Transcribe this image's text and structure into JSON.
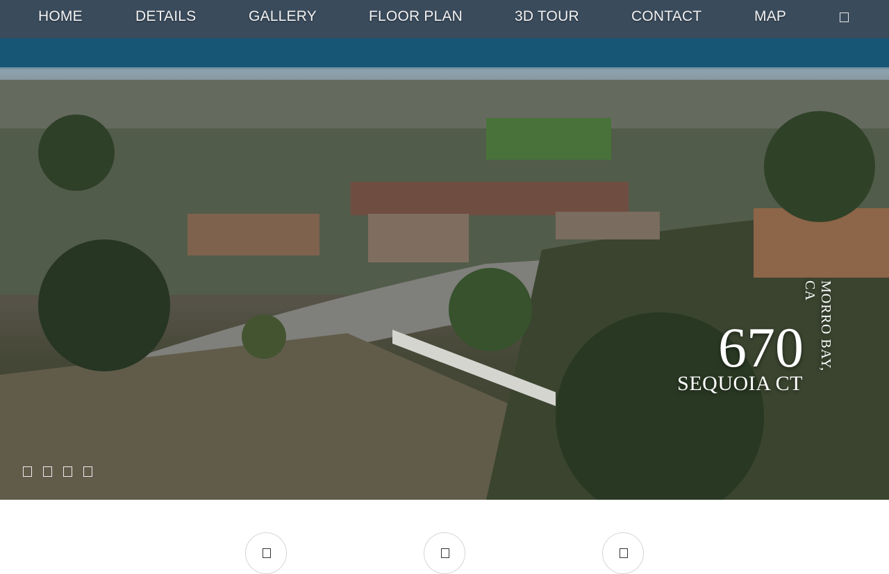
{
  "nav": {
    "items": [
      {
        "label": "HOME"
      },
      {
        "label": "DETAILS"
      },
      {
        "label": "GALLERY"
      },
      {
        "label": "FLOOR PLAN"
      },
      {
        "label": "3D TOUR"
      },
      {
        "label": "CONTACT"
      },
      {
        "label": "MAP"
      }
    ],
    "menu_icon": "menu-icon"
  },
  "hero": {
    "address_number": "670",
    "street": "SEQUOIA CT",
    "city": "MORRO BAY, CA",
    "slide_count": 4
  },
  "features": {
    "icons": [
      "feature-icon",
      "feature-icon",
      "feature-icon"
    ]
  },
  "colors": {
    "nav_text": "#f2f2f2",
    "address_text": "#ffffff",
    "page_background": "#ffffff"
  }
}
